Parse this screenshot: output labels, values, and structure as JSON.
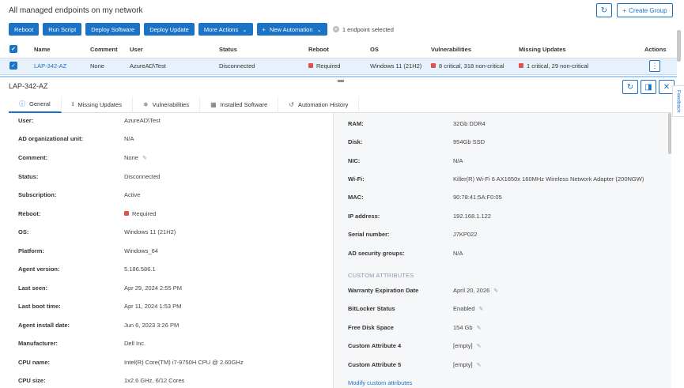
{
  "header": {
    "title": "All managed endpoints on my network",
    "create_group_label": "Create Group"
  },
  "toolbar": {
    "reboot": "Reboot",
    "run_script": "Run Script",
    "deploy_software": "Deploy Software",
    "deploy_update": "Deploy Update",
    "more_actions": "More Actions",
    "new_automation": "New Automation",
    "selected_text": "1 endpoint selected"
  },
  "table": {
    "headers": {
      "name": "Name",
      "comment": "Comment",
      "user": "User",
      "status": "Status",
      "reboot": "Reboot",
      "os": "OS",
      "vulnerabilities": "Vulnerabilities",
      "missing_updates": "Missing Updates",
      "actions": "Actions"
    },
    "rows": [
      {
        "name": "LAP-342-AZ",
        "comment": "None",
        "user": "AzureAD\\Test",
        "status": "Disconnected",
        "reboot": "Required",
        "os": "Windows 11 (21H2)",
        "vulnerabilities": "8 critical,  318 non-critical",
        "missing_updates": "1 critical,  29 non-critical"
      }
    ]
  },
  "detail": {
    "title": "LAP-342-AZ",
    "tabs": [
      "General",
      "Missing Updates",
      "Vulnerabilities",
      "Installed Software",
      "Automation History"
    ],
    "left": {
      "user": {
        "label": "User:",
        "value": "AzureAD\\Test"
      },
      "ad_ou": {
        "label": "AD organizational unit:",
        "value": "N/A"
      },
      "comment": {
        "label": "Comment:",
        "value": "None"
      },
      "status": {
        "label": "Status:",
        "value": "Disconnected"
      },
      "subscription": {
        "label": "Subscription:",
        "value": "Active"
      },
      "reboot": {
        "label": "Reboot:",
        "value": "Required"
      },
      "os": {
        "label": "OS:",
        "value": "Windows 11 (21H2)"
      },
      "platform": {
        "label": "Platform:",
        "value": "Windows_64"
      },
      "agent_version": {
        "label": "Agent version:",
        "value": "5.186.586.1"
      },
      "last_seen": {
        "label": "Last seen:",
        "value": "Apr 29, 2024 2:55 PM"
      },
      "last_boot": {
        "label": "Last boot time:",
        "value": "Apr 11, 2024 1:53 PM"
      },
      "agent_install": {
        "label": "Agent install date:",
        "value": "Jun 6, 2023 3:26 PM"
      },
      "manufacturer": {
        "label": "Manufacturer:",
        "value": "Dell Inc."
      },
      "cpu_name": {
        "label": "CPU name:",
        "value": "Intel(R) Core(TM) i7-9750H CPU @ 2.60GHz"
      },
      "cpu_size": {
        "label": "CPU size:",
        "value": "1x2.6 GHz, 6/12 Cores"
      }
    },
    "right": {
      "ram": {
        "label": "RAM:",
        "value": "32Gb DDR4"
      },
      "disk": {
        "label": "Disk:",
        "value": "954Gb SSD"
      },
      "nic": {
        "label": "NIC:",
        "value": "N/A"
      },
      "wifi": {
        "label": "Wi-Fi:",
        "value": "Killer(R) Wi-Fi 6 AX1650x 160MHz Wireless Network Adapter (200NGW)"
      },
      "mac": {
        "label": "MAC:",
        "value": "90:78:41:5A:F0:05"
      },
      "ip": {
        "label": "IP address:",
        "value": "192.168.1.122"
      },
      "serial": {
        "label": "Serial number:",
        "value": "J7KP022"
      },
      "ad_groups": {
        "label": "AD security groups:",
        "value": "N/A"
      },
      "custom_heading": "CUSTOM ATTRIBUTES",
      "warranty": {
        "label": "Warranty Expiration Date",
        "value": "April 20, 2026"
      },
      "bitlocker": {
        "label": "BitLocker Status",
        "value": "Enabled"
      },
      "free_disk": {
        "label": "Free Disk Space",
        "value": "154 Gb"
      },
      "custom4": {
        "label": "Custom Attribute 4",
        "value": "[empty]"
      },
      "custom5": {
        "label": "Custom Attribute 5",
        "value": "[empty]"
      },
      "modify_link": "Modify custom attributes"
    }
  },
  "feedback_label": "Feedback",
  "colors": {
    "accent": "#1a73c7",
    "danger": "#e05252"
  }
}
